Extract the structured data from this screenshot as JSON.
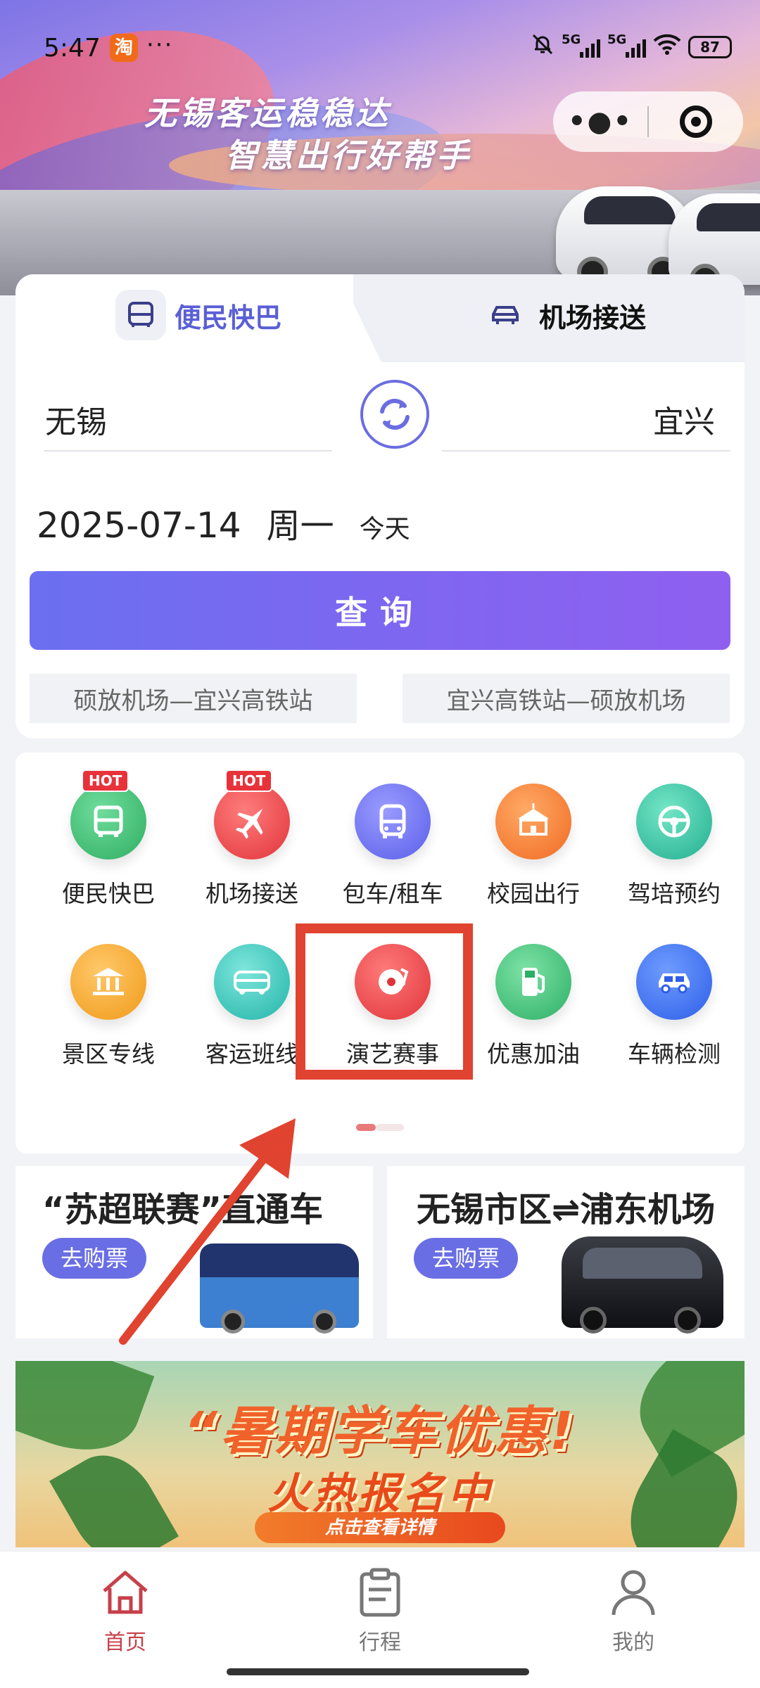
{
  "status_bar": {
    "time": "5:47",
    "app_badge": "淘",
    "overflow": "···",
    "network_1": "5G",
    "network_2": "5G",
    "battery": "87"
  },
  "banner": {
    "slogan_line1": "无锡客运稳稳达",
    "slogan_line2": "智慧出行好帮手"
  },
  "capsule": {
    "more": "•●•"
  },
  "tabs": [
    {
      "label": "便民快巴",
      "icon": "bus-icon",
      "active": true
    },
    {
      "label": "机场接送",
      "icon": "car-icon",
      "active": false
    }
  ],
  "search": {
    "from_city": "无锡",
    "to_city": "宜兴",
    "date": "2025-07-14",
    "weekday": "周一",
    "today_label": "今天",
    "query_button": "查询"
  },
  "quick_routes": [
    "硕放机场—宜兴高铁站",
    "宜兴高铁站—硕放机场"
  ],
  "services": [
    {
      "label": "便民快巴",
      "icon": "bus-icon",
      "hot": "HOT",
      "color": "#3fb874"
    },
    {
      "label": "机场接送",
      "icon": "airplane-icon",
      "hot": "HOT",
      "color": "#e8484c"
    },
    {
      "label": "包车/租车",
      "icon": "coach-icon",
      "hot": "",
      "color": "#6a6ef0"
    },
    {
      "label": "校园出行",
      "icon": "school-icon",
      "hot": "",
      "color": "#f5823a"
    },
    {
      "label": "驾培预约",
      "icon": "steering-wheel-icon",
      "hot": "",
      "color": "#3cc0a0"
    },
    {
      "label": "景区专线",
      "icon": "landmark-icon",
      "hot": "",
      "color": "#f5a623"
    },
    {
      "label": "客运班线",
      "icon": "shuttle-bus-icon",
      "hot": "",
      "color": "#3cc4b8"
    },
    {
      "label": "演艺赛事",
      "icon": "music-disc-icon",
      "hot": "",
      "color": "#e8484c"
    },
    {
      "label": "优惠加油",
      "icon": "fuel-pump-icon",
      "hot": "",
      "color": "#3fbe7a"
    },
    {
      "label": "车辆检测",
      "icon": "car-inspection-icon",
      "hot": "",
      "color": "#3e6ff0"
    }
  ],
  "promos": [
    {
      "title": "“苏超联赛”直通车",
      "button": "去购票"
    },
    {
      "title": "无锡市区⇌浦东机场",
      "button": "去购票"
    }
  ],
  "summer_banner": {
    "title": "“暑期学车优惠!",
    "subtitle": "火热报名中",
    "cta": "点击查看详情"
  },
  "bottom_nav": [
    {
      "label": "首页",
      "icon": "home-icon",
      "active": true
    },
    {
      "label": "行程",
      "icon": "clipboard-icon",
      "active": false
    },
    {
      "label": "我的",
      "icon": "user-icon",
      "active": false
    }
  ],
  "colors": {
    "accent": "#6a6ee4",
    "highlight": "#e0432f",
    "nav_active": "#c6404a"
  }
}
